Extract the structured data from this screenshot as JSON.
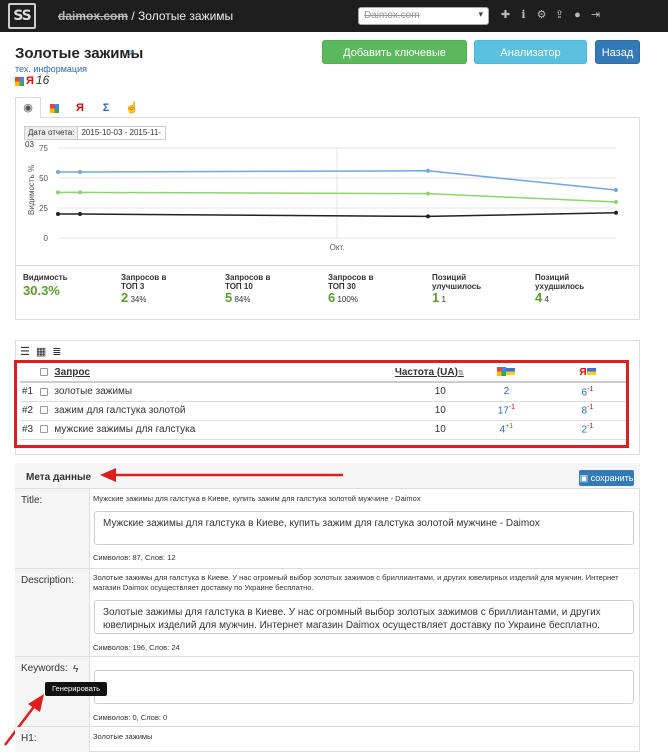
{
  "topbar": {
    "logo": "SS",
    "domain": "daimox.com",
    "separator": " / ",
    "page": "Золотые зажимы",
    "site_select": "Daimox.com",
    "icons": [
      "plus-icon",
      "info-icon",
      "settings-icon",
      "upload-icon",
      "user-icon",
      "logout-icon"
    ]
  },
  "header": {
    "title": "Золотые зажимы",
    "tech_info": "тех. информация",
    "score_ya": "Я",
    "score_value": "16"
  },
  "buttons": {
    "add_keywords": "Добавить ключевые запросы",
    "page_analyzer": "Анализатор страницы",
    "back": "Назад"
  },
  "tabs": [
    "eye-icon",
    "google-icon",
    "yandex-icon",
    "sigma-icon",
    "pointer-icon"
  ],
  "tab_ya": "Я",
  "tab_sigma": "Σ",
  "chart": {
    "report_date_label": "Дата отчета:",
    "report_date_value": "2015-10-03 - 2015-11-03",
    "ylabel": "Видимость %"
  },
  "chart_data": {
    "type": "line",
    "title": "",
    "xlabel": "",
    "ylabel": "Видимость %",
    "x_tick_labels": [
      "Окт."
    ],
    "y_ticks": [
      0,
      25,
      50,
      75
    ],
    "ylim": [
      0,
      75
    ],
    "grid": true,
    "series": [
      {
        "color": "#6fa6e6",
        "values": [
          55,
          55,
          56,
          40
        ]
      },
      {
        "color": "#8fd36b",
        "values": [
          38,
          38,
          37,
          30
        ]
      },
      {
        "color": "#222222",
        "values": [
          20,
          20,
          18,
          21
        ]
      }
    ]
  },
  "stats": [
    {
      "label": "Видимость",
      "value": "30.3%"
    },
    {
      "label": "Запросов в ТОП 3",
      "value": "2",
      "pct": "34%"
    },
    {
      "label": "Запросов в ТОП 10",
      "value": "5",
      "pct": "84%"
    },
    {
      "label": "Запросов в ТОП 30",
      "value": "6",
      "pct": "100%"
    },
    {
      "label": "Позиций улучшилось",
      "value": "1",
      "pct": "1"
    },
    {
      "label": "Позиций ухудшилось",
      "value": "4",
      "pct": "4"
    }
  ],
  "keywords": {
    "col_query": "Запрос",
    "col_freq": "Частота (UA)",
    "ya": "Я",
    "rows": [
      {
        "num": "#1",
        "query": "золотые зажимы",
        "freq": "10",
        "g": "2",
        "g_delta": "",
        "y": "6",
        "y_delta": "-1"
      },
      {
        "num": "#2",
        "query": "зажим для галстука золотой",
        "freq": "10",
        "g": "17",
        "g_delta": "-1",
        "y": "8",
        "y_delta": "-1"
      },
      {
        "num": "#3",
        "query": "мужские зажимы для галстука",
        "freq": "10",
        "g": "4",
        "g_delta": "+1",
        "y": "2",
        "y_delta": "-1"
      }
    ]
  },
  "meta": {
    "heading": "Мета данные",
    "save": "сохранить",
    "title_label": "Title:",
    "title_hint": "Мужские зажимы для галстука в Киеве, купить зажим для галстука золотой мужчине - Daimox",
    "title_value": "Мужские зажимы для галстука в Киеве, купить зажим для галстука золотой мужчине - Daimox",
    "title_count": "Символов: 87, Слов: 12",
    "desc_label": "Description:",
    "desc_hint": "Золотые зажимы для галстука в Киеве. У нас огромный выбор золотых зажимов с бриллиантами, и других ювелирных изделий для мужчин. Интернет магазин Daimox осуществляет доставку по Украине бесплатно.",
    "desc_value": "Золотые зажимы для галстука в Киеве. У нас огромный выбор золотых зажимов с бриллиантами, и других ювелирных изделий для мужчин. Интернет магазин Daimox осуществляет доставку по Украине бесплатно.",
    "desc_count": "Символов: 196, Слов: 24",
    "kw_label": "Keywords:",
    "kw_value": "",
    "kw_count": "Символов: 0, Слов: 0",
    "generate_tooltip": "Генерировать",
    "h1_label": "H1:",
    "h1_hint": "Золотые зажимы"
  }
}
